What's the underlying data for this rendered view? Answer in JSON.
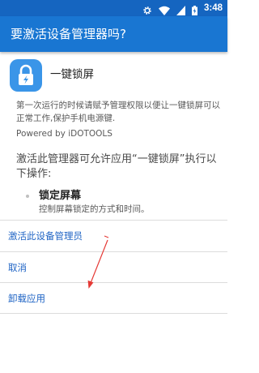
{
  "status_bar": {
    "time": "3:48",
    "icons": [
      "settings-gear-icon",
      "wifi-icon",
      "signal-icon",
      "battery-charging-icon"
    ]
  },
  "dialog": {
    "title": "要激活设备管理器吗?"
  },
  "app": {
    "icon": "lock-icon",
    "name": "一键锁屏",
    "description": "第一次运行的时候请赋予管理权限以便让一键锁屏可以正常工作,保护手机电源键.",
    "powered_by": "Powered by iDOTOOLS"
  },
  "permissions": {
    "header": "激活此管理器可允许应用“一键锁屏”执行以下操作:",
    "items": [
      {
        "title": "锁定屏幕",
        "description": "控制屏幕锁定的方式和时间。"
      }
    ]
  },
  "actions": {
    "activate": "激活此设备管理员",
    "cancel": "取消",
    "uninstall": "卸载应用"
  },
  "annotation": {
    "color": "#e53935"
  },
  "colors": {
    "status_bar": "#1565c0",
    "app_bar": "#1976d2",
    "accent_text": "#1e63c4"
  }
}
